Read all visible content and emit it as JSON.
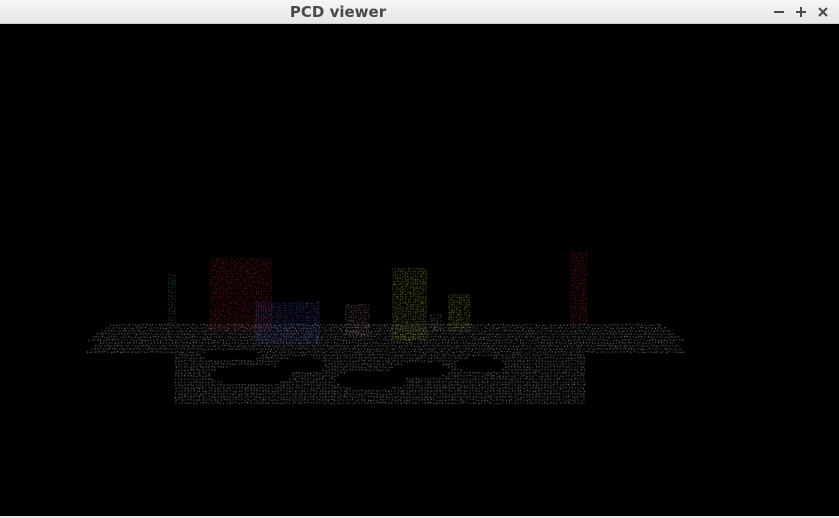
{
  "window": {
    "title": "PCD viewer",
    "controls": {
      "minimize_icon": "minimize-icon",
      "maximize_icon": "maximize-icon",
      "close_icon": "close-icon"
    }
  },
  "viewport": {
    "background": "#000000",
    "point_colors": {
      "floor": "#e6e6e6",
      "red_object": "#c8283c",
      "blue_object": "#5a64e6",
      "yellow_object": "#d2d250",
      "green_object": "#5ab46e",
      "pink_object": "#c89696"
    }
  }
}
